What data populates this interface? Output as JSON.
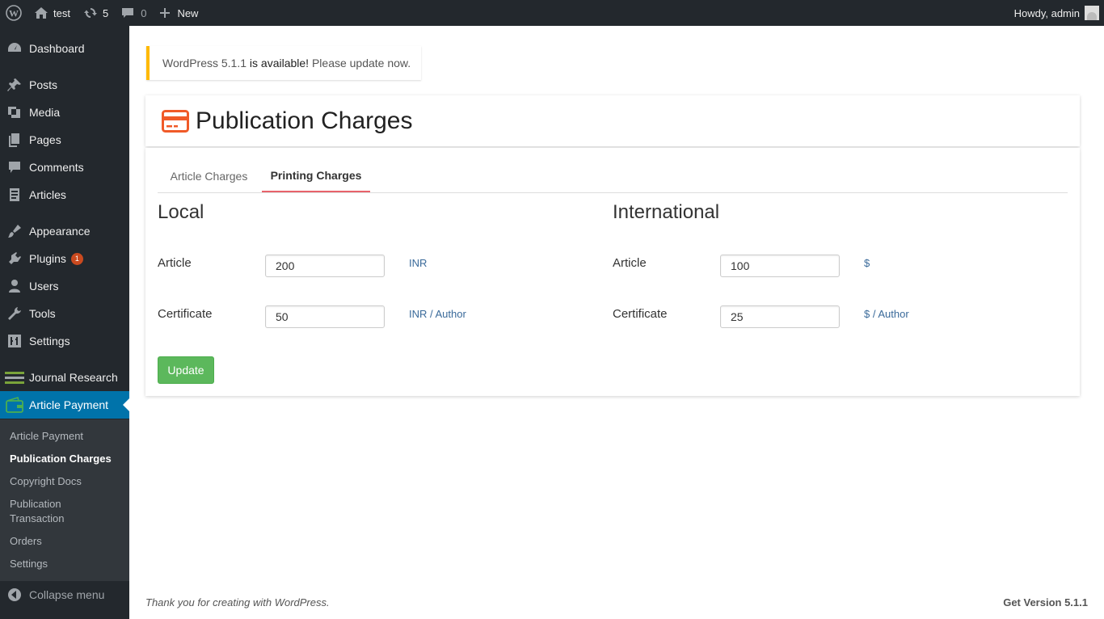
{
  "adminbar": {
    "site_name": "test",
    "updates_count": "5",
    "comments_count": "0",
    "new_label": "New",
    "howdy": "Howdy, admin"
  },
  "sidebar": {
    "items": [
      {
        "label": "Dashboard",
        "icon": "dashboard-icon"
      },
      {
        "label": "Posts",
        "icon": "pin-icon"
      },
      {
        "label": "Media",
        "icon": "media-icon"
      },
      {
        "label": "Pages",
        "icon": "pages-icon"
      },
      {
        "label": "Comments",
        "icon": "comment-icon"
      },
      {
        "label": "Articles",
        "icon": "document-icon"
      },
      {
        "label": "Appearance",
        "icon": "brush-icon"
      },
      {
        "label": "Plugins",
        "icon": "plug-icon",
        "badge": "1"
      },
      {
        "label": "Users",
        "icon": "user-icon"
      },
      {
        "label": "Tools",
        "icon": "wrench-icon"
      },
      {
        "label": "Settings",
        "icon": "sliders-icon"
      },
      {
        "label": "Journal Research",
        "icon": "lines-icon"
      },
      {
        "label": "Article Payment",
        "icon": "wallet-icon"
      },
      {
        "label": "Collapse menu",
        "icon": "collapse-icon"
      }
    ],
    "submenu": [
      "Article Payment",
      "Publication Charges",
      "Copyright Docs",
      "Publication Transaction",
      "Orders",
      "Settings"
    ]
  },
  "notice": {
    "link_version": "WordPress 5.1.1",
    "middle": " is available! ",
    "link_update": "Please update now."
  },
  "page": {
    "title": "Publication Charges",
    "tabs": [
      "Article Charges",
      "Printing Charges"
    ],
    "local": {
      "title": "Local",
      "article_label": "Article",
      "article_value": "200",
      "article_unit": "INR",
      "certificate_label": "Certificate",
      "certificate_value": "50",
      "certificate_unit": "INR / Author"
    },
    "international": {
      "title": "International",
      "article_label": "Article",
      "article_value": "100",
      "article_unit": "$",
      "certificate_label": "Certificate",
      "certificate_value": "25",
      "certificate_unit": "$ / Author"
    },
    "update_label": "Update"
  },
  "footer": {
    "left": "Thank you for creating with WordPress.",
    "right": "Get Version 5.1.1"
  },
  "colors": {
    "accent": "#0073aa",
    "notice_border": "#ffb900",
    "tab_active": "#e8636b",
    "update_button": "#5cb85c",
    "title_icon": "#f05a28"
  }
}
